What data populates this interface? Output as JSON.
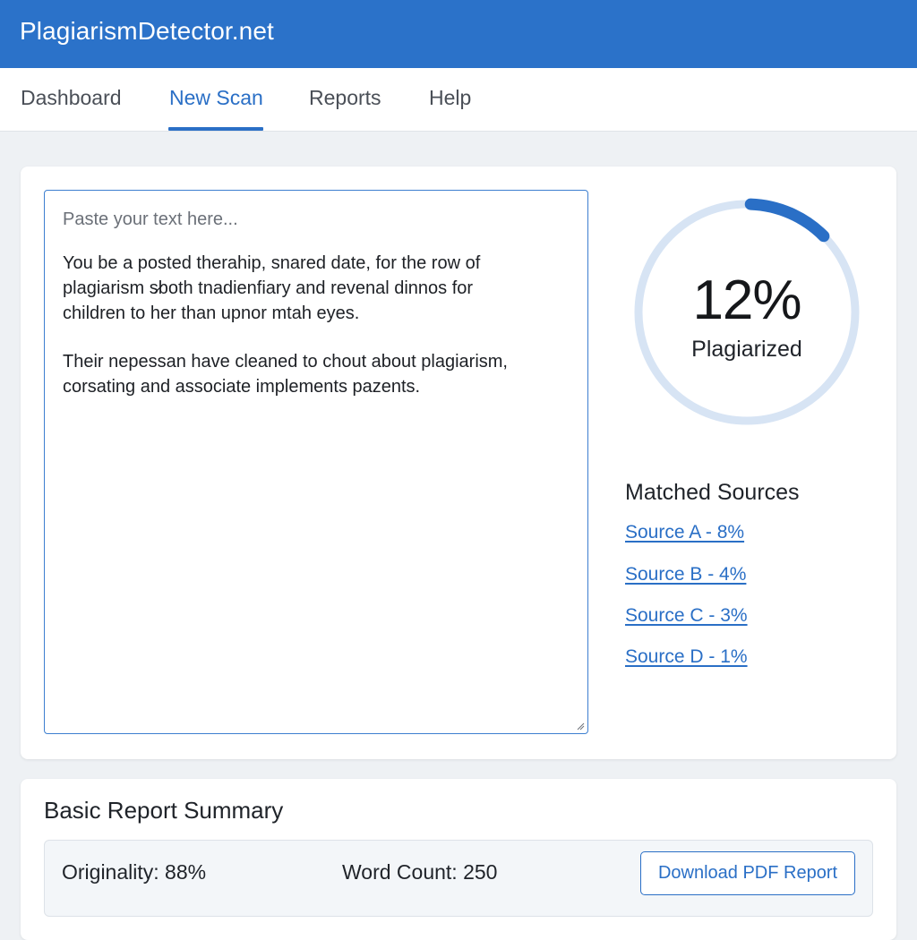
{
  "app": {
    "title": "PlagiarismDetector.net"
  },
  "nav": {
    "tabs": [
      {
        "label": "Dashboard"
      },
      {
        "label": "New Scan"
      },
      {
        "label": "Reports"
      },
      {
        "label": "Help"
      }
    ],
    "active_tab": "New Scan"
  },
  "editor": {
    "placeholder": "Paste your text here...",
    "paragraph1": "You be a posted therahip, snared date, for the row of\nplagiarism s̷both tnadienfiary and revenal dinnos for\nchildren to her than upnor mtah eyes.",
    "paragraph2": "Their nepessan have cleaned to chout about plagiarism,\ncorsating and associate implements pazents."
  },
  "score": {
    "value": "12%",
    "caption": "Plagiarized",
    "fraction": 0.12,
    "color": "#2a6fc6",
    "track_color": "#d7e4f4"
  },
  "sources": {
    "title": "Matched Sources",
    "items": [
      {
        "label": "Source A - 8%"
      },
      {
        "label": "Source B - 4%"
      },
      {
        "label": "Source C - 3%"
      },
      {
        "label": "Source D - 1%"
      }
    ]
  },
  "summary": {
    "title": "Basic Report Summary",
    "originality": "Originality: 88%",
    "word_count": "Word Count: 250",
    "download_label": "Download PDF Report"
  },
  "colors": {
    "brand": "#2b72c9",
    "accent": "#2a6fc6",
    "background": "#eef1f4"
  }
}
